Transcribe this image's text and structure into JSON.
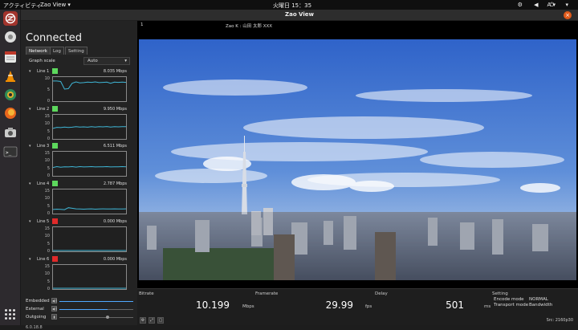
{
  "topbar": {
    "activities": "アクティビティ",
    "app": "Zao View ▾",
    "clock": "火曜日 15：35",
    "lang": "A ▾",
    "tray": "⚙ ◀ ⏻ ▾"
  },
  "window": {
    "title": "Zao View",
    "close": "×"
  },
  "status": "Connected",
  "tabs": [
    "Network",
    "Log",
    "Setting"
  ],
  "graph_scale": {
    "label": "Graph scale",
    "value": "Auto"
  },
  "lines": [
    {
      "name": "Line 1",
      "color": "#5dd85d",
      "rate": "8.035 Mbps",
      "ticks": [
        "10",
        "5",
        "0"
      ],
      "trace": [
        8.6,
        8.6,
        8.4,
        5.0,
        5.2,
        7.6,
        8.2,
        7.8,
        7.9,
        8.1,
        8.0,
        8.2,
        7.9,
        8.0,
        8.1,
        7.6,
        8.1,
        8.0,
        8.1,
        8.0
      ]
    },
    {
      "name": "Line 2",
      "color": "#5dd85d",
      "rate": "9.950 Mbps",
      "ticks": [
        "15",
        "10",
        "5",
        "0"
      ],
      "trace": [
        6.5,
        7.2,
        7.0,
        7.4,
        7.1,
        7.3,
        7.6,
        7.4,
        7.5,
        7.3,
        7.6,
        7.4,
        7.6,
        7.5,
        7.7,
        7.4,
        7.6,
        7.5,
        7.6,
        7.6
      ]
    },
    {
      "name": "Line 3",
      "color": "#5dd85d",
      "rate": "6.511 Mbps",
      "ticks": [
        "15",
        "10",
        "5",
        "0"
      ],
      "trace": [
        5.0,
        5.6,
        5.2,
        5.5,
        5.4,
        5.6,
        5.3,
        5.6,
        5.4,
        5.5,
        5.6,
        5.4,
        5.5,
        5.5,
        5.6,
        5.4,
        5.5,
        5.5,
        5.6,
        5.5
      ]
    },
    {
      "name": "Line 4",
      "color": "#5dd85d",
      "rate": "2.787 Mbps",
      "ticks": [
        "15",
        "10",
        "5",
        "0"
      ],
      "trace": [
        2.2,
        2.4,
        2.3,
        2.1,
        3.4,
        3.0,
        2.6,
        2.5,
        2.4,
        2.5,
        2.6,
        2.4,
        2.5,
        2.6,
        2.5,
        2.5,
        2.6,
        2.5,
        2.5,
        2.6
      ]
    },
    {
      "name": "Line 5",
      "color": "#e02a2a",
      "rate": "0.000 Mbps",
      "ticks": [
        "15",
        "10",
        "5",
        "0"
      ],
      "trace": [
        0,
        0,
        0,
        0,
        0,
        0,
        0,
        0,
        0,
        0,
        0,
        0,
        0,
        0,
        0,
        0,
        0,
        0,
        0,
        0
      ]
    },
    {
      "name": "Line 6",
      "color": "#e02a2a",
      "rate": "0.000 Mbps",
      "ticks": [
        "15",
        "10",
        "5",
        "0"
      ],
      "trace": [
        0,
        0,
        0,
        0,
        0,
        0,
        0,
        0,
        0,
        0,
        0,
        0,
        0,
        0,
        0,
        0,
        0,
        0,
        0,
        0
      ]
    }
  ],
  "audio": [
    {
      "label": "Embedded",
      "icon": "◀))",
      "level": 1.0
    },
    {
      "label": "External",
      "icon": "◀))",
      "level": 0.65
    },
    {
      "label": "Outgoing",
      "icon": "▮",
      "level": 0.65
    }
  ],
  "version": "6.0.18.8",
  "video": {
    "index": "1",
    "name": "Zao K : 山田 太郎 XXX"
  },
  "stats": {
    "bitrate": {
      "label": "Bitrate",
      "value": "10.199",
      "unit": "Mbps"
    },
    "framerate": {
      "label": "Framerate",
      "value": "29.99",
      "unit": "fps"
    },
    "delay": {
      "label": "Delay",
      "value": "501",
      "unit": "ms"
    },
    "setting": {
      "label": "Setting",
      "encode_key": "Encode mode",
      "encode_val": "NORMAL",
      "transport_key": "Transport mode",
      "transport_val": "Bandwidth"
    },
    "source": "Src: 2160p30"
  }
}
